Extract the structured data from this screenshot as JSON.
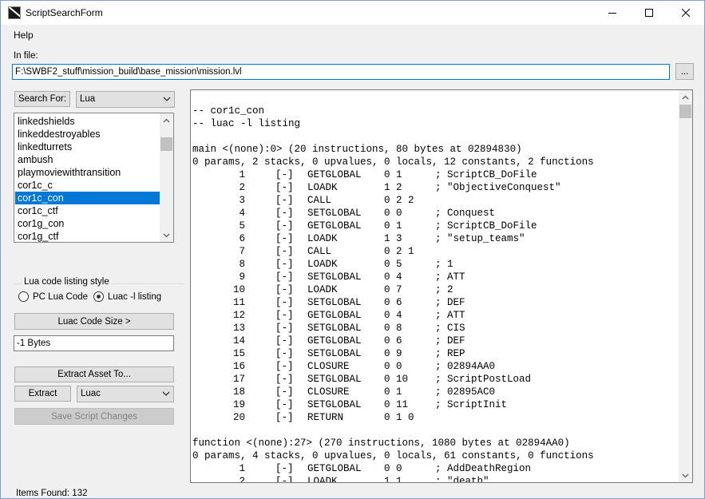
{
  "window": {
    "title": "ScriptSearchForm",
    "icon": "app-icon",
    "controls": [
      "minimize-icon",
      "maximize-icon",
      "close-icon"
    ]
  },
  "menu": {
    "items": [
      "Help"
    ]
  },
  "infile": {
    "label": "In file:",
    "value": "F:\\SWBF2_stuff\\mission_build\\base_mission\\mission.lvl",
    "browse_label": "..."
  },
  "search": {
    "button_label": "Search For:",
    "type_selected": "Lua"
  },
  "list": {
    "items": [
      "linkedshields",
      "linkeddestroyables",
      "linkedturrets",
      "ambush",
      "playmoviewithtransition",
      "cor1c_c",
      "cor1c_con",
      "cor1c_ctf",
      "cor1g_con",
      "cor1g_ctf"
    ],
    "selected_index": 6
  },
  "listing_style": {
    "title": "Lua code listing style",
    "options": [
      "PC Lua Code",
      "Luac -l listing"
    ],
    "selected_index": 1
  },
  "code_size": {
    "button_label": "Luac Code Size >",
    "value": "-1 Bytes"
  },
  "actions": {
    "extract_to_label": "Extract Asset To...",
    "extract_label": "Extract",
    "extract_format": "Luac",
    "save_label": "Save Script Changes"
  },
  "code": {
    "lines": [
      "",
      "-- cor1c_con",
      "-- luac -l listing",
      "",
      "main <(none):0> (20 instructions, 80 bytes at 02894830)",
      "0 params, 2 stacks, 0 upvalues, 0 locals, 12 constants, 2 functions",
      "\t1\t[-]\tGETGLOBAL\t0 1\t; ScriptCB_DoFile",
      "\t2\t[-]\tLOADK\t1 2\t; \"ObjectiveConquest\"",
      "\t3\t[-]\tCALL\t0 2 2",
      "\t4\t[-]\tSETGLOBAL\t0 0\t; Conquest",
      "\t5\t[-]\tGETGLOBAL\t0 1\t; ScriptCB_DoFile",
      "\t6\t[-]\tLOADK\t1 3\t; \"setup_teams\"",
      "\t7\t[-]\tCALL\t0 2 1",
      "\t8\t[-]\tLOADK\t0 5\t; 1",
      "\t9\t[-]\tSETGLOBAL\t0 4\t; ATT",
      "\t10\t[-]\tLOADK\t0 7\t; 2",
      "\t11\t[-]\tSETGLOBAL\t0 6\t; DEF",
      "\t12\t[-]\tGETGLOBAL\t0 4\t; ATT",
      "\t13\t[-]\tSETGLOBAL\t0 8\t; CIS",
      "\t14\t[-]\tGETGLOBAL\t0 6\t; DEF",
      "\t15\t[-]\tSETGLOBAL\t0 9\t; REP",
      "\t16\t[-]\tCLOSURE\t0 0\t; 02894AA0",
      "\t17\t[-]\tSETGLOBAL\t0 10\t; ScriptPostLoad",
      "\t18\t[-]\tCLOSURE\t0 1\t; 02895AC0",
      "\t19\t[-]\tSETGLOBAL\t0 11\t; ScriptInit",
      "\t20\t[-]\tRETURN\t0 1 0",
      "",
      "function <(none):27> (270 instructions, 1080 bytes at 02894AA0)",
      "0 params, 4 stacks, 0 upvalues, 0 locals, 61 constants, 0 functions",
      "\t1\t[-]\tGETGLOBAL\t0 0\t; AddDeathRegion",
      "\t2\t[-]\tLOADK\t1 1\t; \"death\""
    ]
  },
  "status": {
    "text": "Items Found: 132"
  }
}
